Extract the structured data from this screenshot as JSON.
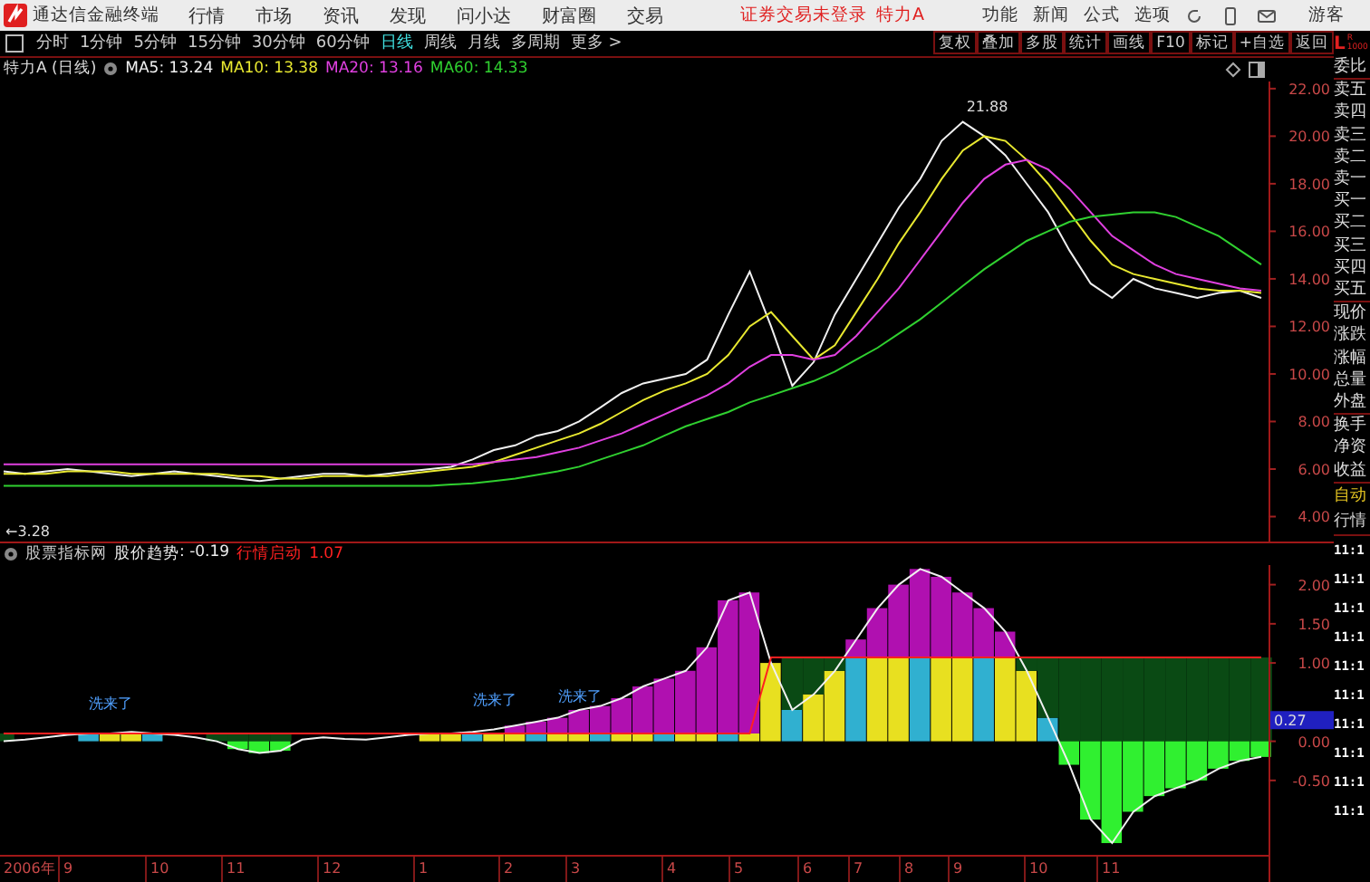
{
  "menubar": {
    "app_title": "通达信金融终端",
    "items": [
      "行情",
      "市场",
      "资讯",
      "发现",
      "问小达",
      "财富圈",
      "交易"
    ],
    "login_status": "证券交易未登录",
    "stock_name": "特力A",
    "right_items": [
      "功能",
      "新闻",
      "公式",
      "选项"
    ],
    "user": "游客"
  },
  "toolbar": {
    "periods": [
      {
        "label": "分时",
        "selected": false
      },
      {
        "label": "1分钟",
        "selected": false
      },
      {
        "label": "5分钟",
        "selected": false
      },
      {
        "label": "15分钟",
        "selected": false
      },
      {
        "label": "30分钟",
        "selected": false
      },
      {
        "label": "60分钟",
        "selected": false
      },
      {
        "label": "日线",
        "selected": true
      },
      {
        "label": "周线",
        "selected": false
      },
      {
        "label": "月线",
        "selected": false
      },
      {
        "label": "多周期",
        "selected": false
      },
      {
        "label": "更多 >",
        "selected": false
      }
    ],
    "buttons": [
      "复权",
      "叠加",
      "多股",
      "统计",
      "画线",
      "F10",
      "标记",
      "+自选",
      "返回"
    ]
  },
  "price_panel": {
    "title": "特力A (日线)",
    "legend_values": [
      ": 13.24",
      ": 13.38",
      ": 13.16",
      ": 14.33"
    ],
    "chart_data": {
      "type": "line",
      "ylim": [
        2.8,
        22.3
      ],
      "yticks": [
        {
          "value": 4,
          "label": "4.00"
        },
        {
          "value": 6,
          "label": "6.00"
        },
        {
          "value": 8,
          "label": "8.00"
        },
        {
          "value": 10,
          "label": "10.00"
        },
        {
          "value": 12,
          "label": "12.00"
        },
        {
          "value": 14,
          "label": "14.00"
        },
        {
          "value": 16,
          "label": "16.00"
        },
        {
          "value": 18,
          "label": "18.00"
        },
        {
          "value": 20,
          "label": "20.00"
        },
        {
          "value": 22,
          "label": "22.00"
        }
      ],
      "series": [
        {
          "name": "MA5",
          "color": "#f0f0f0",
          "values": [
            5.9,
            5.8,
            5.9,
            6.0,
            5.9,
            5.8,
            5.7,
            5.8,
            5.9,
            5.8,
            5.7,
            5.6,
            5.5,
            5.6,
            5.7,
            5.8,
            5.8,
            5.7,
            5.8,
            5.9,
            6.0,
            6.1,
            6.4,
            6.8,
            7.0,
            7.4,
            7.6,
            8.0,
            8.6,
            9.2,
            9.6,
            9.8,
            10.0,
            10.6,
            12.5,
            14.3,
            12.0,
            9.5,
            10.5,
            12.5,
            14.0,
            15.5,
            17.0,
            18.2,
            19.8,
            20.6,
            20.0,
            19.2,
            18.0,
            16.8,
            15.2,
            13.8,
            13.2,
            14.0,
            13.6,
            13.4,
            13.2,
            13.4,
            13.5,
            13.2
          ]
        },
        {
          "name": "MA10",
          "color": "#e8e830",
          "values": [
            5.8,
            5.8,
            5.8,
            5.9,
            5.9,
            5.9,
            5.8,
            5.8,
            5.8,
            5.8,
            5.8,
            5.7,
            5.7,
            5.6,
            5.6,
            5.7,
            5.7,
            5.7,
            5.7,
            5.8,
            5.9,
            6.0,
            6.1,
            6.3,
            6.6,
            6.9,
            7.2,
            7.5,
            7.9,
            8.4,
            8.9,
            9.3,
            9.6,
            10.0,
            10.8,
            12.0,
            12.6,
            11.6,
            10.6,
            11.2,
            12.6,
            14.0,
            15.5,
            16.8,
            18.2,
            19.4,
            20.0,
            19.8,
            19.0,
            18.0,
            16.8,
            15.6,
            14.6,
            14.2,
            14.0,
            13.8,
            13.6,
            13.5,
            13.5,
            13.4
          ]
        },
        {
          "name": "MA20",
          "color": "#e040e0",
          "values": [
            6.2,
            6.2,
            6.2,
            6.2,
            6.2,
            6.2,
            6.2,
            6.2,
            6.2,
            6.2,
            6.2,
            6.2,
            6.2,
            6.2,
            6.2,
            6.2,
            6.2,
            6.2,
            6.2,
            6.2,
            6.2,
            6.2,
            6.2,
            6.3,
            6.4,
            6.5,
            6.7,
            6.9,
            7.2,
            7.5,
            7.9,
            8.3,
            8.7,
            9.1,
            9.6,
            10.3,
            10.8,
            10.8,
            10.6,
            10.8,
            11.6,
            12.6,
            13.6,
            14.8,
            16.0,
            17.2,
            18.2,
            18.8,
            19.0,
            18.6,
            17.8,
            16.8,
            15.8,
            15.2,
            14.6,
            14.2,
            14.0,
            13.8,
            13.6,
            13.5
          ]
        },
        {
          "name": "MA60",
          "color": "#30d030",
          "values": [
            5.3,
            5.3,
            5.3,
            5.3,
            5.3,
            5.3,
            5.3,
            5.3,
            5.3,
            5.3,
            5.3,
            5.3,
            5.3,
            5.3,
            5.3,
            5.3,
            5.3,
            5.3,
            5.3,
            5.3,
            5.3,
            5.35,
            5.4,
            5.5,
            5.6,
            5.75,
            5.9,
            6.1,
            6.4,
            6.7,
            7.0,
            7.4,
            7.8,
            8.1,
            8.4,
            8.8,
            9.1,
            9.4,
            9.7,
            10.1,
            10.6,
            11.1,
            11.7,
            12.3,
            13.0,
            13.7,
            14.4,
            15.0,
            15.6,
            16.0,
            16.4,
            16.6,
            16.7,
            16.8,
            16.8,
            16.6,
            16.2,
            15.8,
            15.2,
            14.6
          ]
        }
      ],
      "annotations": [
        "21.88",
        "←3.28"
      ]
    }
  },
  "indicator_panel": {
    "name": "股票指标网",
    "trend_value": ": -0.19",
    "start_value": "1.07",
    "current_value": "0.27",
    "chart_data": {
      "type": "line",
      "ylim": [
        -1.45,
        2.25
      ],
      "yticks": [
        {
          "value": 2,
          "label": "2.00"
        },
        {
          "value": 1.5,
          "label": "1.50"
        },
        {
          "value": 1,
          "label": "1.00"
        },
        {
          "value": 0,
          "label": "0.00"
        },
        {
          "value": -0.5,
          "label": "-0.50"
        }
      ],
      "series": [
        {
          "name": "股价趋势",
          "color": "#f0f0f0",
          "values": [
            0.0,
            0.02,
            0.05,
            0.08,
            0.1,
            0.1,
            0.12,
            0.1,
            0.08,
            0.05,
            0.0,
            -0.1,
            -0.15,
            -0.12,
            0.02,
            0.05,
            0.03,
            0.02,
            0.05,
            0.08,
            0.1,
            0.1,
            0.12,
            0.15,
            0.2,
            0.25,
            0.3,
            0.4,
            0.45,
            0.55,
            0.7,
            0.8,
            0.9,
            1.2,
            1.8,
            1.9,
            1.0,
            0.4,
            0.6,
            0.9,
            1.3,
            1.7,
            2.0,
            2.2,
            2.1,
            1.9,
            1.7,
            1.4,
            0.9,
            0.3,
            -0.3,
            -1.0,
            -1.3,
            -0.9,
            -0.7,
            -0.6,
            -0.5,
            -0.35,
            -0.25,
            -0.2
          ]
        },
        {
          "name": "行情启动",
          "color": "#ff2020",
          "values": [
            0.1,
            0.1,
            0.1,
            0.1,
            0.1,
            0.1,
            0.1,
            0.1,
            0.1,
            0.1,
            0.1,
            0.1,
            0.1,
            0.1,
            0.1,
            0.1,
            0.1,
            0.1,
            0.1,
            0.1,
            0.1,
            0.1,
            0.1,
            0.1,
            0.1,
            0.1,
            0.1,
            0.1,
            0.1,
            0.1,
            0.1,
            0.1,
            0.1,
            0.1,
            0.1,
            0.1,
            1.07,
            1.07,
            1.07,
            1.07,
            1.07,
            1.07,
            1.07,
            1.07,
            1.07,
            1.07,
            1.07,
            1.07,
            1.07,
            1.07,
            1.07,
            1.07,
            1.07,
            1.07,
            1.07,
            1.07,
            1.07,
            1.07,
            1.07,
            1.07
          ]
        }
      ],
      "annotations": [
        "洗来了",
        "洗来了",
        "洗来了"
      ]
    },
    "date_axis": [
      "2006年",
      "9",
      "10",
      "11",
      "12",
      "1",
      "2",
      "3",
      "4",
      "5",
      "6",
      "7",
      "8",
      "9",
      "10",
      "11"
    ]
  },
  "side_panel": {
    "header": [
      "L",
      "R",
      "1000"
    ],
    "quote_labels": [
      "委比",
      "卖五",
      "卖四",
      "卖三",
      "卖二",
      "卖一",
      "买一",
      "买二",
      "买三",
      "买四",
      "买五",
      "现价",
      "涨跌",
      "涨幅",
      "总量",
      "外盘",
      "换手",
      "净资",
      "收益"
    ],
    "status": [
      {
        "text": "自动",
        "color": "#e0c020"
      },
      {
        "text": "行情",
        "color": "#d0d0d0"
      }
    ],
    "times": [
      "11:1",
      "11:1",
      "11:1",
      "11:1",
      "11:1",
      "11:1",
      "11:1",
      "11:1",
      "11:1",
      "11:1"
    ]
  }
}
